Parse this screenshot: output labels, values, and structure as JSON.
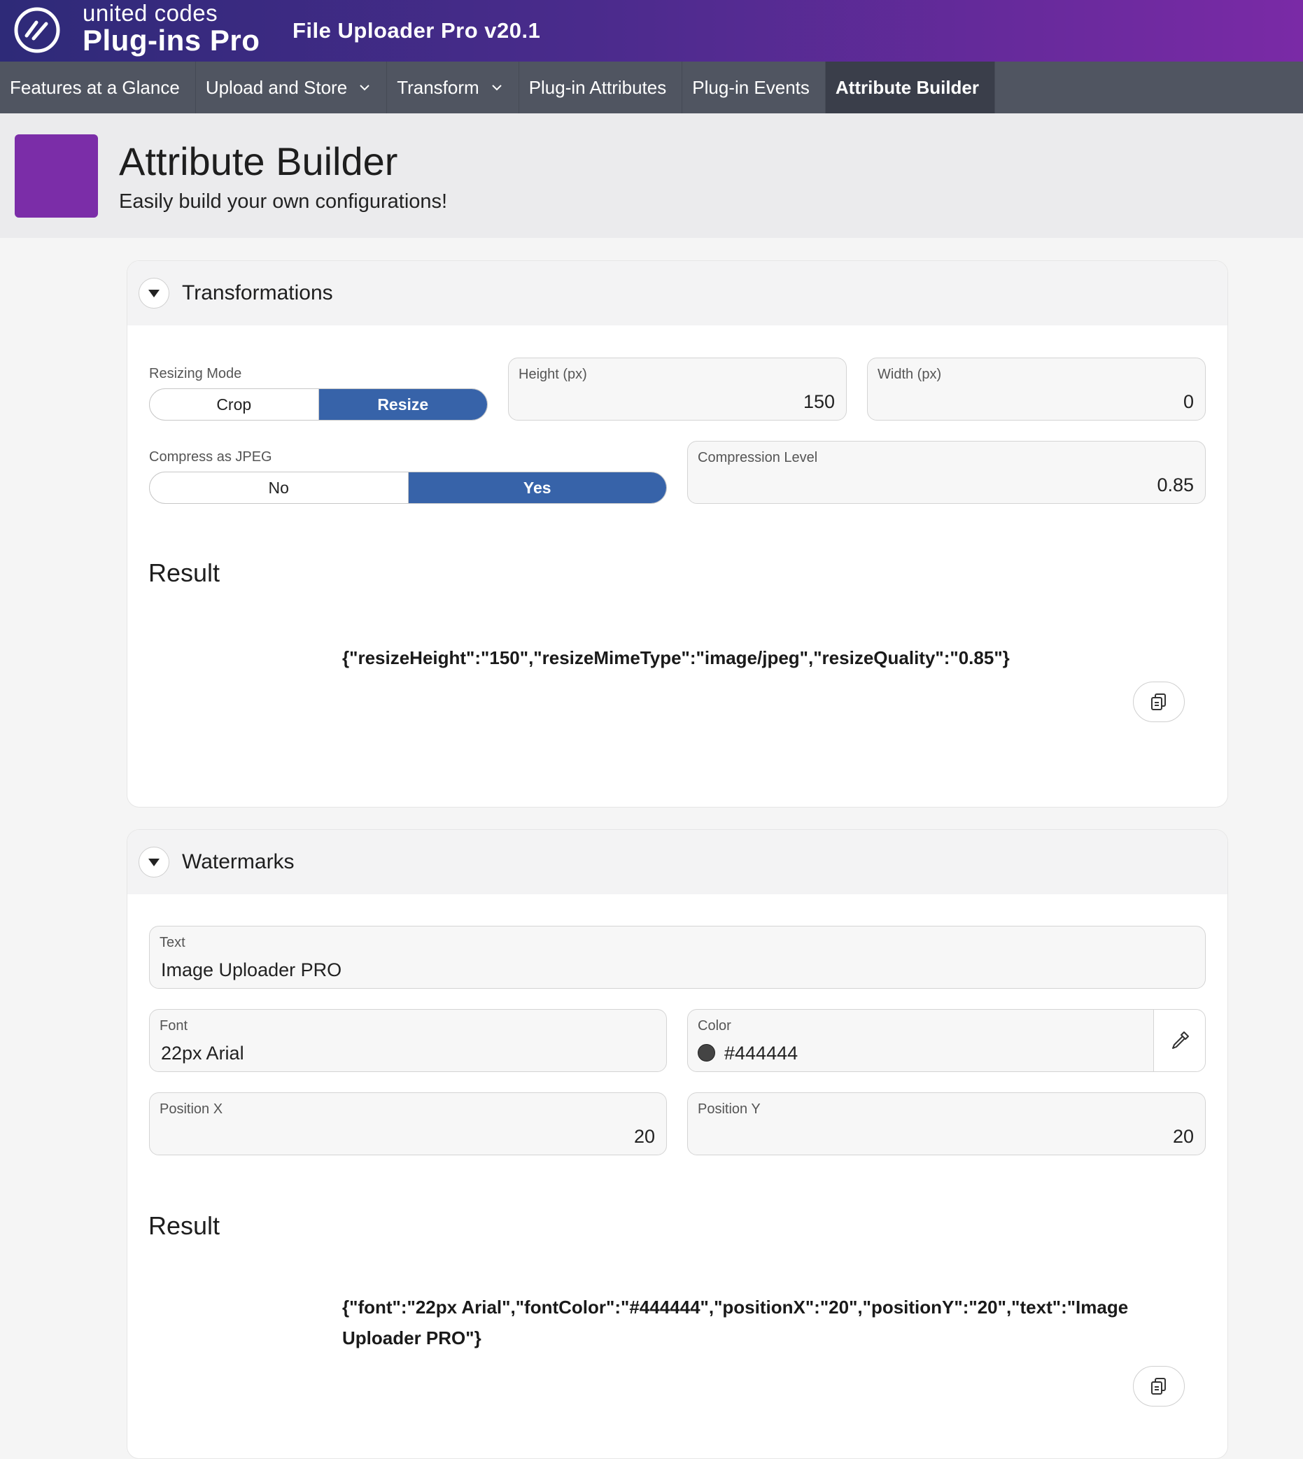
{
  "header": {
    "brand_top": "united codes",
    "brand_main": "Plug-ins Pro",
    "app_title": "File Uploader Pro v20.1"
  },
  "nav": {
    "items": [
      {
        "label": "Features at a Glance"
      },
      {
        "label": "Upload and Store"
      },
      {
        "label": "Transform"
      },
      {
        "label": "Plug-in Attributes"
      },
      {
        "label": "Plug-in Events"
      },
      {
        "label": "Attribute Builder"
      }
    ],
    "active": "Attribute Builder"
  },
  "hero": {
    "title": "Attribute Builder",
    "subtitle": "Easily build your own configurations!"
  },
  "transformations": {
    "title": "Transformations",
    "resizing_mode": {
      "label": "Resizing Mode",
      "options": [
        "Crop",
        "Resize"
      ],
      "selected": "Resize"
    },
    "height": {
      "label": "Height (px)",
      "value": "150"
    },
    "width": {
      "label": "Width (px)",
      "value": "0"
    },
    "compress": {
      "label": "Compress as JPEG",
      "options": [
        "No",
        "Yes"
      ],
      "selected": "Yes"
    },
    "compression_level": {
      "label": "Compression Level",
      "value": "0.85"
    },
    "result_heading": "Result",
    "result_code": "{\"resizeHeight\":\"150\",\"resizeMimeType\":\"image/jpeg\",\"resizeQuality\":\"0.85\"}"
  },
  "watermarks": {
    "title": "Watermarks",
    "text": {
      "label": "Text",
      "value": "Image Uploader PRO"
    },
    "font": {
      "label": "Font",
      "value": "22px Arial"
    },
    "color": {
      "label": "Color",
      "value": "#444444"
    },
    "position_x": {
      "label": "Position X",
      "value": "20"
    },
    "position_y": {
      "label": "Position Y",
      "value": "20"
    },
    "result_heading": "Result",
    "result_code_line1": "{\"font\":\"22px Arial\",\"fontColor\":\"#444444\",\"positionX\":\"20\",\"positionY\":\"20\",\"text\":\"Image",
    "result_code_line2": "Uploader PRO\"}"
  },
  "colors": {
    "accent": "#3763a9",
    "brand_purple": "#7b2da8",
    "nav_bg": "#505561",
    "nav_active": "#3a3e4a"
  },
  "icons": [
    "logo-mark-icon",
    "chevron-down-icon",
    "caret-down-icon",
    "copy-icon",
    "eyedropper-icon"
  ]
}
